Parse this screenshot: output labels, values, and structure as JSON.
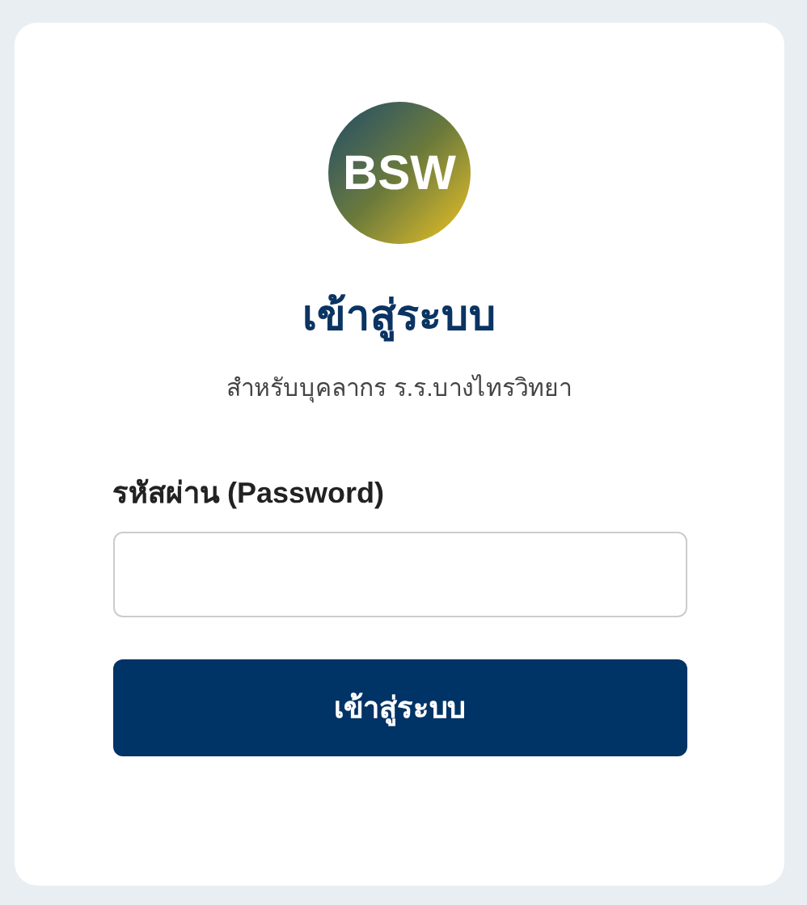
{
  "logo": {
    "text": "BSW"
  },
  "title": "เข้าสู่ระบบ",
  "subtitle": "สำหรับบุคลากร ร.ร.บางไทรวิทยา",
  "password_field": {
    "label": "รหัสผ่าน (Password)"
  },
  "submit_button": {
    "label": "เข้าสู่ระบบ"
  }
}
